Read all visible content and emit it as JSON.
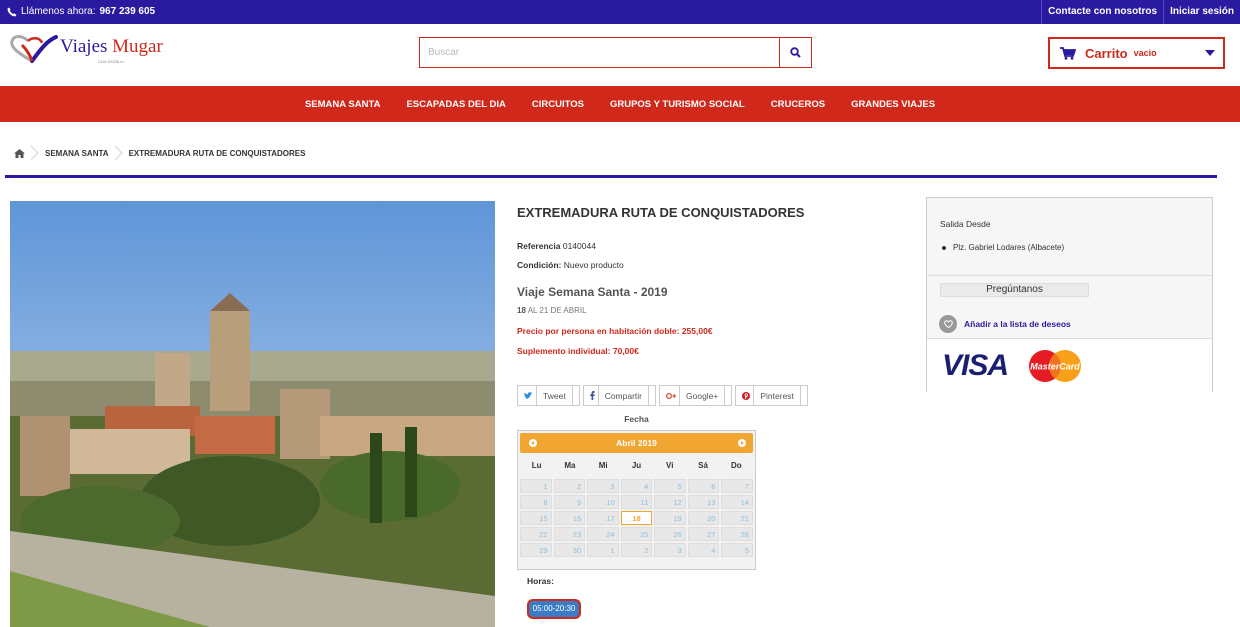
{
  "topbar": {
    "phone_label": "Llámenos ahora:",
    "phone_number": "967 239 605",
    "contact": "Contacte con nosotros",
    "login": "Iniciar sesión"
  },
  "logo": {
    "name_a": "Viajes",
    "name_b": "Mugar",
    "sub": "CLM-02338-m"
  },
  "search": {
    "placeholder": "Buscar"
  },
  "cart": {
    "label": "Carrito",
    "status": "vacio"
  },
  "nav": [
    "SEMANA SANTA",
    "ESCAPADAS DEL DIA",
    "CIRCUITOS",
    "GRUPOS Y TURISMO SOCIAL",
    "CRUCEROS",
    "GRANDES VIAJES"
  ],
  "breadcrumb": {
    "level1": "SEMANA SANTA",
    "level2": "EXTREMADURA RUTA DE CONQUISTADORES"
  },
  "product": {
    "title": "EXTREMADURA RUTA DE CONQUISTADORES",
    "ref_label": "Referencia",
    "ref_value": "0140044",
    "cond_label": "Condición:",
    "cond_value": "Nuevo producto",
    "trip": "Viaje Semana Santa - 2019",
    "dates_day": "18",
    "dates_rest": "AL 21 DE ABRIL",
    "price_double": "Precio por persona en habitación doble: 255,00€",
    "supplement": "Suplemento individual: 70,00€"
  },
  "social": {
    "tweet": "Tweet",
    "share": "Compartir",
    "google": "Google+",
    "pinterest": "Pinterest"
  },
  "calendar": {
    "label": "Fecha",
    "month": "Abril 2019",
    "weekdays": [
      "Lu",
      "Ma",
      "Mi",
      "Ju",
      "Vi",
      "Sá",
      "Do"
    ],
    "days": [
      "1",
      "2",
      "3",
      "4",
      "5",
      "6",
      "7",
      "8",
      "9",
      "10",
      "11",
      "12",
      "13",
      "14",
      "15",
      "16",
      "17",
      "18",
      "19",
      "20",
      "21",
      "22",
      "23",
      "24",
      "25",
      "26",
      "27",
      "28",
      "29",
      "30",
      "1",
      "2",
      "3",
      "4",
      "5"
    ],
    "selected": "18"
  },
  "hours": {
    "label": "Horas:",
    "slot": "05:00-20:30"
  },
  "sidebar": {
    "departure_title": "Salida Desde",
    "departure_place": "Plz. Gabriel Lodares (Albacete)",
    "ask": "Pregúntanos",
    "wishlist": "Añadir a la lista de deseos",
    "visa": "VISA",
    "mastercard": "MasterCard"
  },
  "colors": {
    "brand_blue": "#2a1aa0",
    "brand_red": "#d0291c",
    "calendar_orange": "#f2a632"
  }
}
